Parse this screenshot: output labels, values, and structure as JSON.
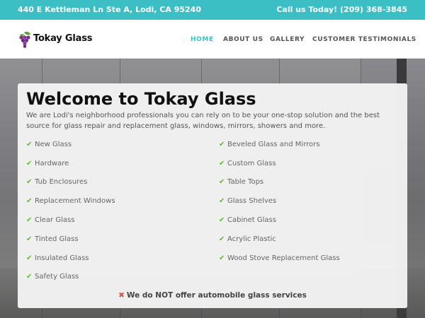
{
  "topbar": {
    "address": "440 E Kettleman Ln Ste A, Lodi, CA 95240",
    "phone": "Call us Today! (209) 368-3845"
  },
  "logo": {
    "text": "Tokay Glass"
  },
  "nav": [
    "HOME",
    "ABOUT US",
    "GALLERY",
    "CUSTOMER TESTIMONIALS"
  ],
  "main": {
    "title": "Welcome to Tokay Glass",
    "intro": "We are Lodi's neighborhood professionals you can rely on to be your one-stop solution and the best source for glass repair and replacement glass, windows, mirrors, showers and more.",
    "services_left": [
      "New Glass",
      "Hardware",
      "Tub Enclosures",
      "Replacement Windows",
      "Clear Glass",
      "Tinted Glass",
      "Insulated Glass",
      "Safety Glass"
    ],
    "services_right": [
      "Beveled Glass and Mirrors",
      "Custom Glass",
      "Table Tops",
      "Glass Shelves",
      "Cabinet Glass",
      "Acrylic Plastic",
      "Wood Stove Replacement Glass"
    ],
    "notice": "We do NOT offer automobile glass services"
  },
  "colors": {
    "accent": "#3bbfc4",
    "check": "#67b832",
    "cross": "#d9534f"
  },
  "icons": {
    "check": "check-icon",
    "cross": "cross-icon",
    "logo": "grapes-icon"
  }
}
